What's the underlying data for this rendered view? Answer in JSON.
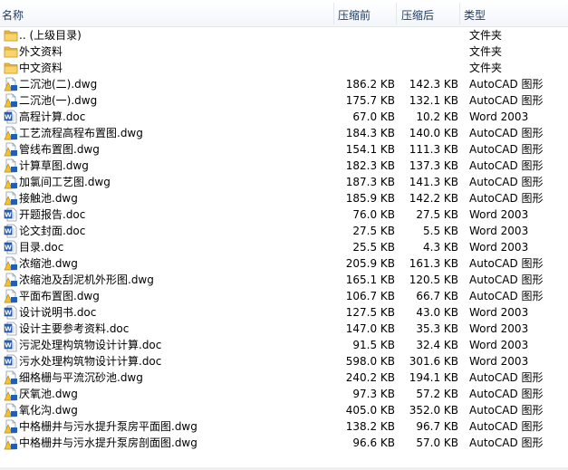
{
  "columns": {
    "name": "名称",
    "before": "压缩前",
    "after": "压缩后",
    "type": "类型"
  },
  "rows": [
    {
      "name": ".. (上级目录)",
      "before": "",
      "after": "",
      "type": "文件夹",
      "icon": "folder-icon"
    },
    {
      "name": "外文资料",
      "before": "",
      "after": "",
      "type": "文件夹",
      "icon": "folder-icon"
    },
    {
      "name": "中文资料",
      "before": "",
      "after": "",
      "type": "文件夹",
      "icon": "folder-icon"
    },
    {
      "name": "二沉池(二).dwg",
      "before": "186.2 KB",
      "after": "142.3 KB",
      "type": "AutoCAD 图形",
      "icon": "dwg-file-icon"
    },
    {
      "name": "二沉池(一).dwg",
      "before": "175.7 KB",
      "after": "132.1 KB",
      "type": "AutoCAD 图形",
      "icon": "dwg-file-icon"
    },
    {
      "name": "高程计算.doc",
      "before": "67.0 KB",
      "after": "10.2 KB",
      "type": "Word 2003",
      "icon": "word-file-icon"
    },
    {
      "name": "工艺流程高程布置图.dwg",
      "before": "184.3 KB",
      "after": "140.0 KB",
      "type": "AutoCAD 图形",
      "icon": "dwg-file-icon"
    },
    {
      "name": "管线布置图.dwg",
      "before": "154.1 KB",
      "after": "111.3 KB",
      "type": "AutoCAD 图形",
      "icon": "dwg-file-icon"
    },
    {
      "name": "计算草图.dwg",
      "before": "182.3 KB",
      "after": "137.3 KB",
      "type": "AutoCAD 图形",
      "icon": "dwg-file-icon"
    },
    {
      "name": "加氯间工艺图.dwg",
      "before": "187.3 KB",
      "after": "141.3 KB",
      "type": "AutoCAD 图形",
      "icon": "dwg-file-icon"
    },
    {
      "name": "接触池.dwg",
      "before": "185.9 KB",
      "after": "142.2 KB",
      "type": "AutoCAD 图形",
      "icon": "dwg-file-icon"
    },
    {
      "name": "开题报告.doc",
      "before": "76.0 KB",
      "after": "27.5 KB",
      "type": "Word 2003",
      "icon": "word-file-icon"
    },
    {
      "name": "论文封面.doc",
      "before": "27.5 KB",
      "after": "5.5 KB",
      "type": "Word 2003",
      "icon": "word-file-icon"
    },
    {
      "name": "目录.doc",
      "before": "25.5 KB",
      "after": "4.3 KB",
      "type": "Word 2003",
      "icon": "word-file-icon"
    },
    {
      "name": "浓缩池.dwg",
      "before": "205.9 KB",
      "after": "161.3 KB",
      "type": "AutoCAD 图形",
      "icon": "dwg-file-icon"
    },
    {
      "name": "浓缩池及刮泥机外形图.dwg",
      "before": "165.1 KB",
      "after": "120.5 KB",
      "type": "AutoCAD 图形",
      "icon": "dwg-file-icon"
    },
    {
      "name": "平面布置图.dwg",
      "before": "106.7 KB",
      "after": "66.7 KB",
      "type": "AutoCAD 图形",
      "icon": "dwg-file-icon"
    },
    {
      "name": "设计说明书.doc",
      "before": "127.5 KB",
      "after": "43.0 KB",
      "type": "Word 2003",
      "icon": "word-file-icon"
    },
    {
      "name": "设计主要参考资料.doc",
      "before": "147.0 KB",
      "after": "35.3 KB",
      "type": "Word 2003",
      "icon": "word-file-icon"
    },
    {
      "name": "污泥处理构筑物设计计算.doc",
      "before": "91.5 KB",
      "after": "32.4 KB",
      "type": "Word 2003",
      "icon": "word-file-icon"
    },
    {
      "name": "污水处理构筑物设计计算.doc",
      "before": "598.0 KB",
      "after": "301.6 KB",
      "type": "Word 2003",
      "icon": "word-file-icon"
    },
    {
      "name": "细格栅与平流沉砂池.dwg",
      "before": "240.2 KB",
      "after": "194.1 KB",
      "type": "AutoCAD 图形",
      "icon": "dwg-file-icon"
    },
    {
      "name": "厌氧池.dwg",
      "before": "97.3 KB",
      "after": "57.2 KB",
      "type": "AutoCAD 图形",
      "icon": "dwg-file-icon"
    },
    {
      "name": "氧化沟.dwg",
      "before": "405.0 KB",
      "after": "352.0 KB",
      "type": "AutoCAD 图形",
      "icon": "dwg-file-icon"
    },
    {
      "name": "中格栅井与污水提升泵房平面图.dwg",
      "before": "138.2 KB",
      "after": "96.7 KB",
      "type": "AutoCAD 图形",
      "icon": "dwg-file-icon"
    },
    {
      "name": "中格栅井与污水提升泵房剖面图.dwg",
      "before": "96.6 KB",
      "after": "57.0 KB",
      "type": "AutoCAD 图形",
      "icon": "dwg-file-icon"
    }
  ]
}
